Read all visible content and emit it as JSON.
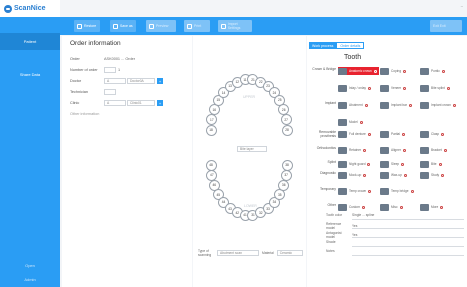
{
  "app": {
    "name": "ScanNice"
  },
  "window": {
    "controls": "–"
  },
  "sidebar": {
    "items": [
      {
        "label": "Patient"
      },
      {
        "label": "Share Data"
      }
    ],
    "bottom": [
      {
        "label": "Open"
      },
      {
        "label": "Admin"
      }
    ]
  },
  "toolbar": {
    "buttons": [
      {
        "label": "Restore"
      },
      {
        "label": "Save as"
      },
      {
        "label": "Preview"
      },
      {
        "label": "Print"
      },
      {
        "label": "Import Settings"
      }
    ],
    "right_label": "Exit Exit"
  },
  "order": {
    "title": "Order information",
    "fields": [
      {
        "label": "Order",
        "value": "ASK0001 ... Order"
      },
      {
        "label": "Number of order",
        "value": "1"
      },
      {
        "label": "Doctor",
        "value": "A",
        "select": "Doctor0A"
      },
      {
        "label": "Technician",
        "value": ""
      },
      {
        "label": "Clinic",
        "value": "A",
        "select": "Clinic01"
      }
    ],
    "more_label": "Other information"
  },
  "teeth": {
    "upper": [
      "18",
      "17",
      "16",
      "15",
      "14",
      "13",
      "12",
      "11",
      "21",
      "22",
      "23",
      "24",
      "25",
      "26",
      "27",
      "28"
    ],
    "lower": [
      "48",
      "47",
      "46",
      "45",
      "44",
      "43",
      "42",
      "41",
      "31",
      "32",
      "33",
      "34",
      "35",
      "36",
      "37",
      "38"
    ],
    "upper_label": "UPPER",
    "lower_label": "LOWER",
    "center_label": "Bite layer"
  },
  "bottom_form": {
    "type_label": "Type of scanning",
    "type_value": "Abutment scan",
    "material_label": "Material",
    "material_value": "Ceramic"
  },
  "right_panel": {
    "tabs": [
      "Work process",
      "Order details"
    ],
    "title": "Tooth",
    "rows": [
      {
        "label": "Crown & Bridge",
        "options": [
          "Anatomic crown",
          "Coping",
          "Pontic"
        ],
        "selected": 0
      },
      {
        "label": "",
        "options": [
          "Inlay / onlay",
          "Veneer",
          "Bite splint"
        ],
        "selected": -1
      },
      {
        "label": "Implant",
        "options": [
          "Abutment",
          "Implant bar",
          "Implant crown"
        ],
        "selected": -1
      },
      {
        "label": "",
        "options": [
          "Model"
        ],
        "selected": -1
      },
      {
        "label": "Removable prosthesis",
        "options": [
          "Full denture",
          "Partial",
          "Clasp"
        ],
        "selected": -1
      },
      {
        "label": "Orthodontics",
        "options": [
          "Retainer",
          "Aligner",
          "Bracket"
        ],
        "selected": -1
      },
      {
        "label": "Splint",
        "options": [
          "Night guard",
          "Sleep",
          "Bite"
        ],
        "selected": -1
      },
      {
        "label": "Diagnostic",
        "options": [
          "Mock-up",
          "Wax-up",
          "Study"
        ],
        "selected": -1
      },
      {
        "label": "Temporary",
        "options": [
          "Temp crown",
          "Temp bridge"
        ],
        "selected": -1
      },
      {
        "label": "Other",
        "options": [
          "Custom",
          "Misc",
          "More"
        ],
        "selected": -1
      }
    ],
    "details": [
      {
        "label": "Tooth color",
        "value": "Single ... spline"
      },
      {
        "label": "Reference model",
        "value": "Yes"
      },
      {
        "label": "Antagonist model",
        "value": "Yes"
      },
      {
        "label": "Shade",
        "value": ""
      },
      {
        "label": "Notes",
        "value": ""
      }
    ]
  }
}
